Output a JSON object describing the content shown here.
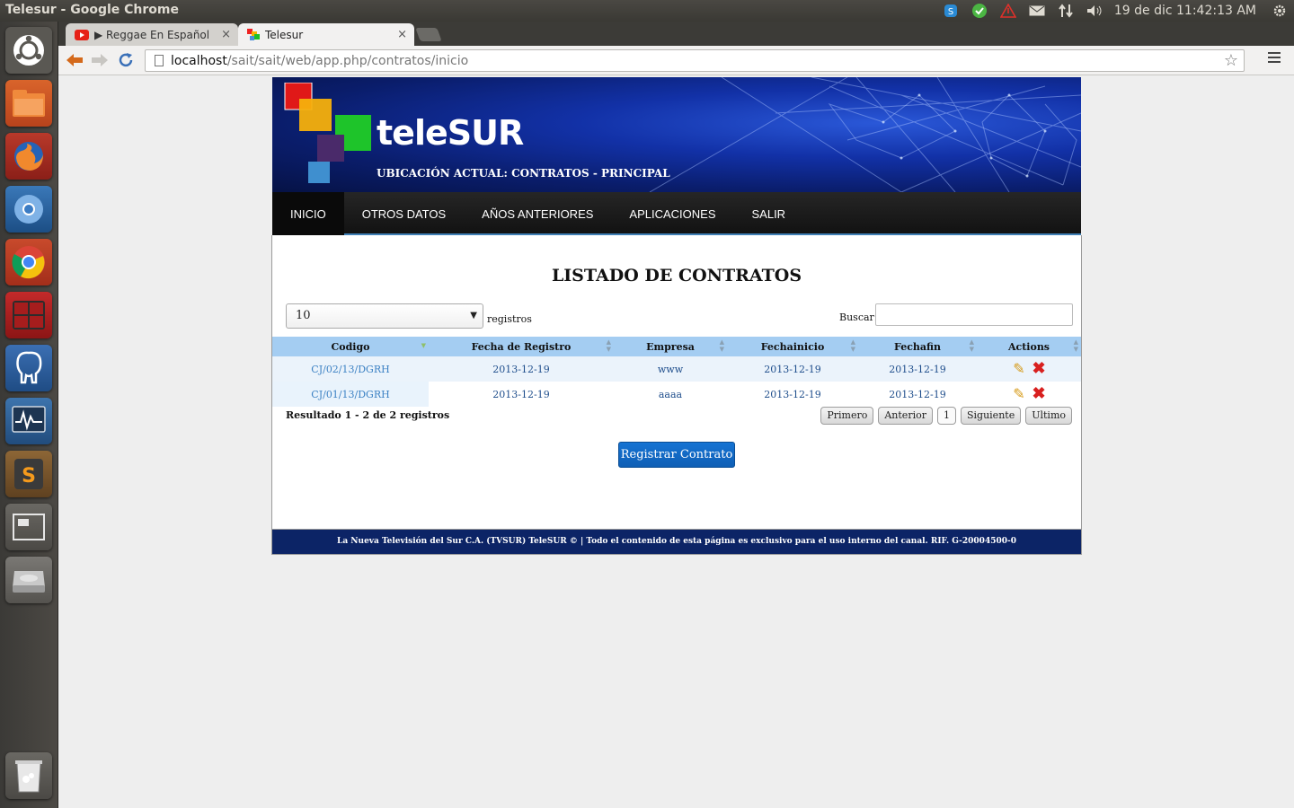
{
  "os_panel": {
    "window_title": "Telesur - Google Chrome",
    "clock": "19 de dic 11:42:13 AM",
    "indicators": [
      "skype-icon",
      "update-ok-icon",
      "alert-icon",
      "mail-icon",
      "network-icon",
      "volume-icon",
      "settings-gear-icon"
    ]
  },
  "launcher": {
    "items": [
      "ubuntu-dash-icon",
      "files-icon",
      "firefox-icon",
      "chromium-icon",
      "chrome-icon",
      "terminal-icon",
      "postgres-elephant-icon",
      "system-monitor-icon",
      "sublime-text-icon",
      "workspace-switcher-icon",
      "disk-drive-icon",
      "trash-icon"
    ]
  },
  "browser": {
    "tabs": [
      {
        "label": "▶ Reggae En Español Ron",
        "close": "×",
        "icon": "youtube-icon"
      },
      {
        "label": "Telesur",
        "close": "×",
        "icon": "telesur-favicon"
      }
    ],
    "url_host": "localhost",
    "url_path": "/sait/sait/web/app.php/contratos/inicio"
  },
  "page": {
    "brand": "teleSUR",
    "location": "UBICACIÓN ACTUAL: CONTRATOS - PRINCIPAL",
    "nav": [
      {
        "label": "INICIO",
        "active": true
      },
      {
        "label": "OTROS DATOS",
        "active": false
      },
      {
        "label": "AÑOS ANTERIORES",
        "active": false
      },
      {
        "label": "APLICACIONES",
        "active": false
      },
      {
        "label": "SALIR",
        "active": false
      }
    ],
    "title": "LISTADO DE CONTRATOS",
    "length_select": {
      "value": "10",
      "suffix": "registros"
    },
    "search": {
      "label": "Buscar:",
      "value": ""
    },
    "table": {
      "columns": [
        "Codigo",
        "Fecha de Registro",
        "Empresa",
        "Fechainicio",
        "Fechafin",
        "Actions"
      ],
      "rows": [
        [
          "CJ/02/13/DGRH",
          "2013-12-19",
          "www",
          "2013-12-19",
          "2013-12-19"
        ],
        [
          "CJ/01/13/DGRH",
          "2013-12-19",
          "aaaa",
          "2013-12-19",
          "2013-12-19"
        ]
      ]
    },
    "result_info": "Resultado 1 - 2 de 2 registros",
    "pager": [
      "Primero",
      "Anterior",
      "1",
      "Siguiente",
      "Ultimo"
    ],
    "register_button": "Registrar Contrato",
    "footer": "La Nueva Televisión del Sur C.A. (TVSUR) TeleSUR © | Todo el contenido de esta página es exclusivo para el uso interno del canal. RIF. G-20004500-0"
  },
  "colors": {
    "table_header": "#a4cdf2",
    "link": "#3d82c4",
    "register_button": "#1573d3",
    "footer": "#0c2466",
    "navbar": "#1a1a1a"
  }
}
